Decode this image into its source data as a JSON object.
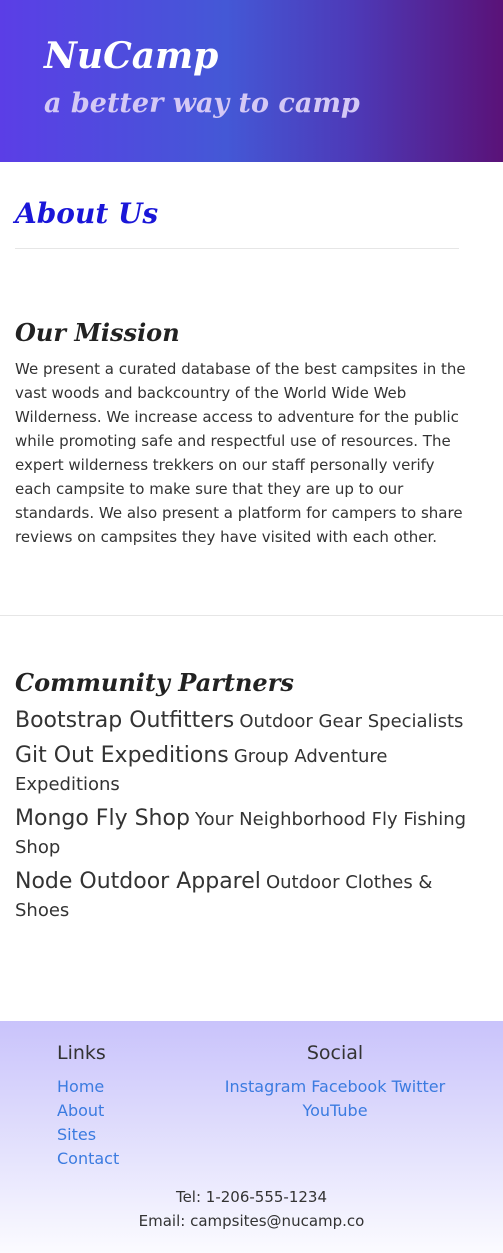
{
  "header": {
    "brand": "NuCamp",
    "tagline": "a better way to camp"
  },
  "page": {
    "title": "About Us"
  },
  "mission": {
    "title": "Our Mission",
    "text": "We present a curated database of the best campsites in the vast woods and backcountry of the World Wide Web Wilderness. We increase access to adventure for the public while promoting safe and respectful use of resources. The expert wilderness trekkers on our staff personally verify each campsite to make sure that they are up to our standards. We also present a platform for campers to share reviews on campsites they have visited with each other."
  },
  "partners": {
    "title": "Community Partners",
    "items": [
      {
        "name": "Bootstrap Outfitters",
        "description": "Outdoor Gear Specialists"
      },
      {
        "name": "Git Out Expeditions",
        "description": "Group Adventure Expeditions"
      },
      {
        "name": "Mongo Fly Shop",
        "description": "Your Neighborhood Fly Fishing Shop"
      },
      {
        "name": "Node Outdoor Apparel",
        "description": "Outdoor Clothes & Shoes"
      }
    ]
  },
  "footer": {
    "links_title": "Links",
    "links": [
      "Home",
      "About",
      "Sites",
      "Contact"
    ],
    "social_title": "Social",
    "social": [
      "Instagram",
      "Facebook",
      "Twitter",
      "YouTube"
    ],
    "phone": "Tel: 1-206-555-1234",
    "email": "Email: campsites@nucamp.co"
  },
  "colors": {
    "title_blue": "#1a16d8",
    "link_blue": "#3b7be0"
  }
}
